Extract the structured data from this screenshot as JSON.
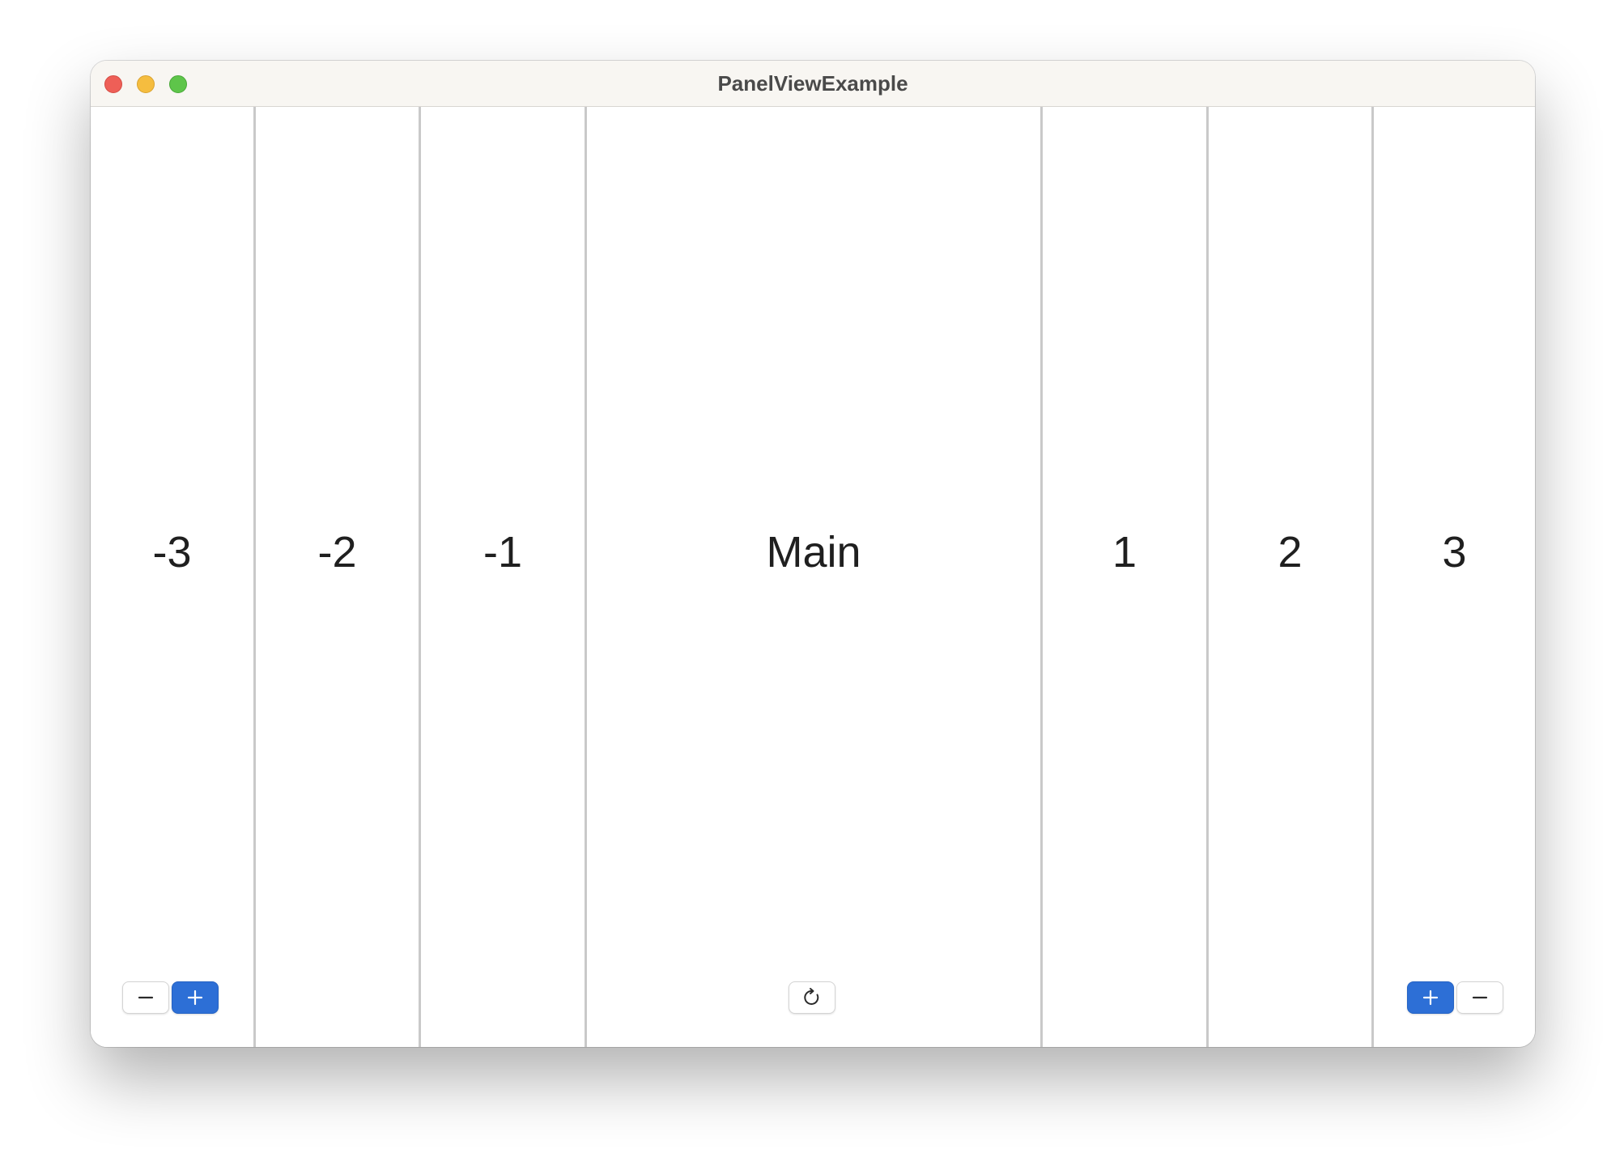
{
  "window": {
    "title": "PanelViewExample"
  },
  "panels": {
    "left3": {
      "label": "-3"
    },
    "left2": {
      "label": "-2"
    },
    "left1": {
      "label": "-1"
    },
    "main": {
      "label": "Main"
    },
    "right1": {
      "label": "1"
    },
    "right2": {
      "label": "2"
    },
    "right3": {
      "label": "3"
    }
  },
  "buttons": {
    "left_remove_icon": "minus-icon",
    "left_add_icon": "plus-icon",
    "refresh_icon": "refresh-icon",
    "right_add_icon": "plus-icon",
    "right_remove_icon": "minus-icon"
  },
  "colors": {
    "accent": "#2d6fd6",
    "close": "#ee5f57",
    "minimize": "#f5bd3f",
    "maximize": "#5ec54a"
  }
}
